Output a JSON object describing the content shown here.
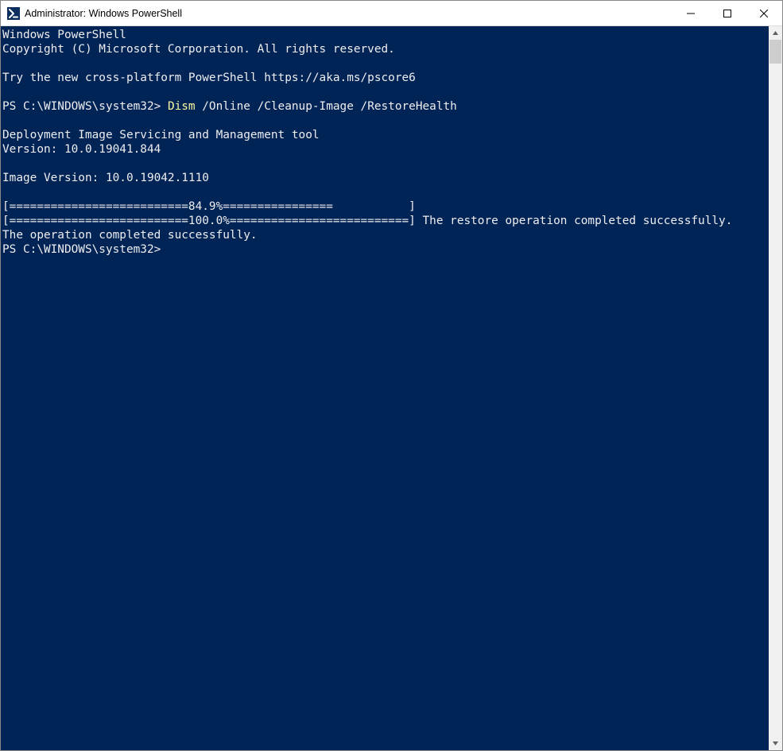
{
  "window": {
    "title": "Administrator: Windows PowerShell"
  },
  "terminal": {
    "header1": "Windows PowerShell",
    "header2": "Copyright (C) Microsoft Corporation. All rights reserved.",
    "promo": "Try the new cross-platform PowerShell https://aka.ms/pscore6",
    "prompt1_prefix": "PS C:\\WINDOWS\\system32> ",
    "cmd_keyword": "Dism",
    "cmd_rest": " /Online /Cleanup-Image /RestoreHealth",
    "out1": "Deployment Image Servicing and Management tool",
    "out2": "Version: 10.0.19041.844",
    "out3": "Image Version: 10.0.19042.1110",
    "progress1": "[==========================84.9%================           ]",
    "progress2": "[==========================100.0%==========================] The restore operation completed successfully.",
    "out4": "The operation completed successfully.",
    "prompt2": "PS C:\\WINDOWS\\system32>"
  }
}
